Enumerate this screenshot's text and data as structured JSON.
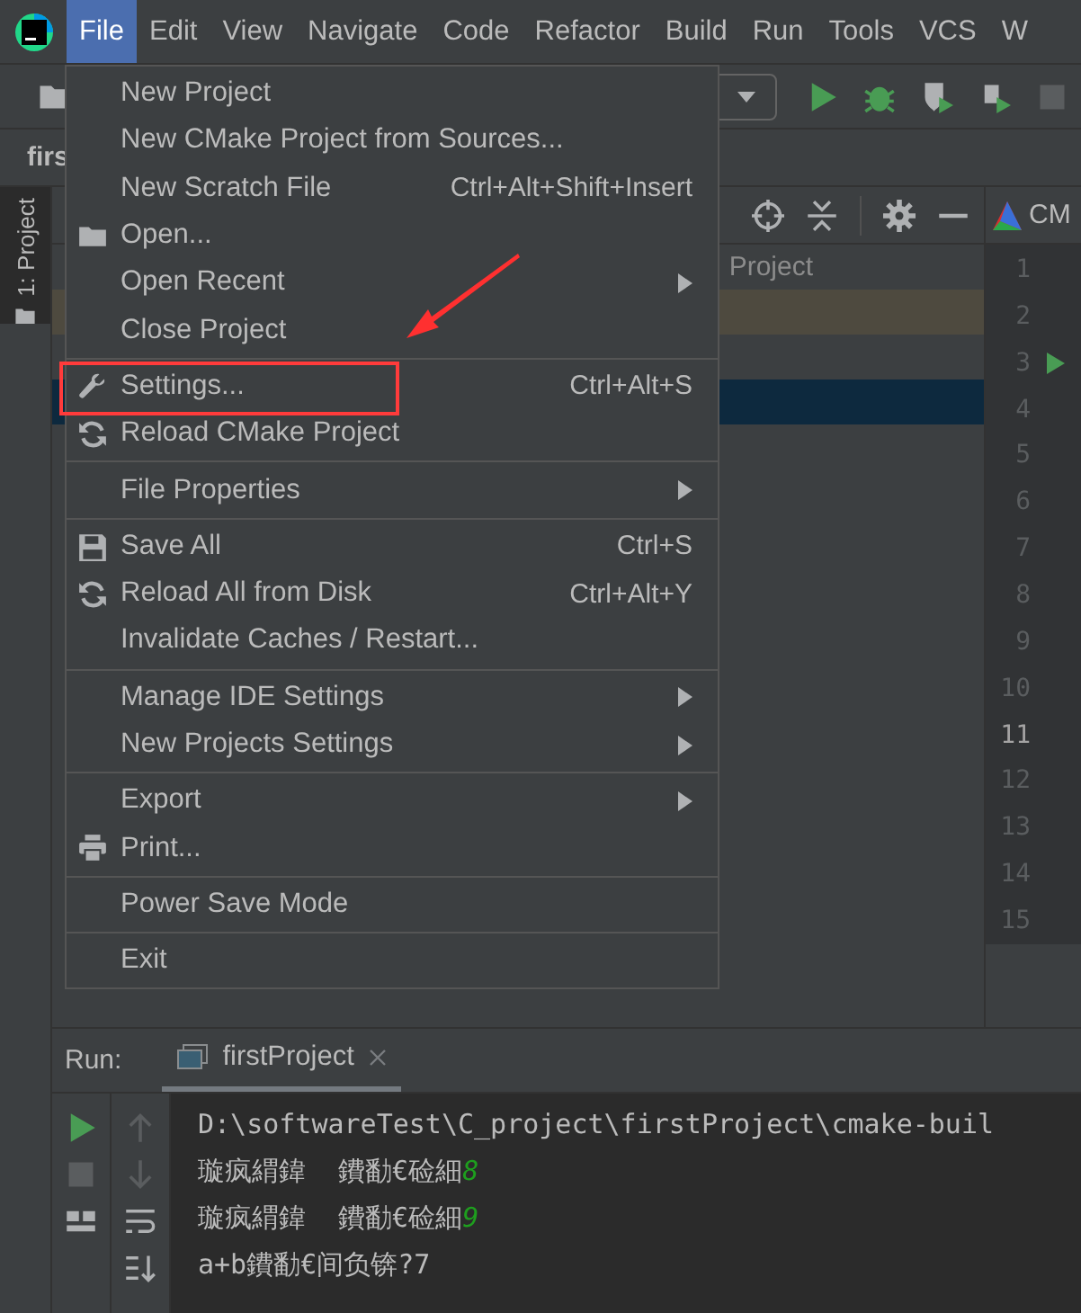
{
  "menubar": {
    "items": [
      {
        "label": "File",
        "selected": true
      },
      {
        "label": "Edit",
        "selected": false
      },
      {
        "label": "View",
        "selected": false
      },
      {
        "label": "Navigate",
        "selected": false
      },
      {
        "label": "Code",
        "selected": false
      },
      {
        "label": "Refactor",
        "selected": false
      },
      {
        "label": "Build",
        "selected": false
      },
      {
        "label": "Run",
        "selected": false
      },
      {
        "label": "Tools",
        "selected": false
      },
      {
        "label": "VCS",
        "selected": false
      },
      {
        "label": "W",
        "selected": false
      }
    ]
  },
  "navigation_bar": {
    "label": "firs"
  },
  "tool_strip": {
    "tab": "1: Project"
  },
  "project_panel": {
    "row_text": "Project"
  },
  "editor": {
    "tab": "CM",
    "lines": [
      {
        "number": "1",
        "current": false
      },
      {
        "number": "2",
        "current": false
      },
      {
        "number": "3",
        "current": false
      },
      {
        "number": "4",
        "current": false
      },
      {
        "number": "5",
        "current": false
      },
      {
        "number": "6",
        "current": false
      },
      {
        "number": "7",
        "current": false
      },
      {
        "number": "8",
        "current": false
      },
      {
        "number": "9",
        "current": false
      },
      {
        "number": "10",
        "current": false
      },
      {
        "number": "11",
        "current": true
      },
      {
        "number": "12",
        "current": false
      },
      {
        "number": "13",
        "current": false
      },
      {
        "number": "14",
        "current": false
      },
      {
        "number": "15",
        "current": false
      }
    ]
  },
  "file_menu": {
    "sections": [
      [
        {
          "label": "New Project"
        },
        {
          "label": "New CMake Project from Sources..."
        },
        {
          "label": "New Scratch File",
          "shortcut": "Ctrl+Alt+Shift+Insert"
        },
        {
          "label": "Open..."
        },
        {
          "label": "Open Recent",
          "submenu": true
        },
        {
          "label": "Close Project"
        }
      ],
      [
        {
          "label": "Settings...",
          "shortcut": "Ctrl+Alt+S",
          "highlighted": true
        },
        {
          "label": "Reload CMake Project"
        }
      ],
      [
        {
          "label": "File Properties",
          "submenu": true
        }
      ],
      [
        {
          "label": "Save All",
          "shortcut": "Ctrl+S"
        },
        {
          "label": "Reload All from Disk",
          "shortcut": "Ctrl+Alt+Y"
        },
        {
          "label": "Invalidate Caches / Restart..."
        }
      ],
      [
        {
          "label": "Manage IDE Settings",
          "submenu": true
        },
        {
          "label": "New Projects Settings",
          "submenu": true
        }
      ],
      [
        {
          "label": "Export",
          "submenu": true
        },
        {
          "label": "Print..."
        }
      ],
      [
        {
          "label": "Power Save Mode"
        }
      ],
      [
        {
          "label": "Exit"
        }
      ]
    ]
  },
  "run_panel": {
    "title": "Run:",
    "tab": "firstProject",
    "console": [
      {
        "text": "D:\\softwareTest\\C_project\\firstProject\\cmake-buil"
      },
      {
        "text": "璇疯緭鍏  鐨勫€硷細",
        "input": "8"
      },
      {
        "text": "璇疯緭鍏  鐨勫€硷細",
        "input": "9"
      },
      {
        "text": "a+b鐨勫€间负锛?7"
      }
    ]
  }
}
